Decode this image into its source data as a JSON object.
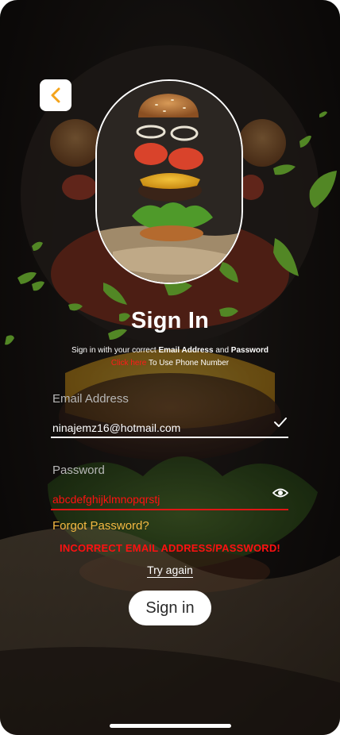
{
  "screen": {
    "title": "Sign In",
    "subtitle_part1": "Sign in with your correct ",
    "subtitle_bold1": "Email Address",
    "subtitle_and": " and ",
    "subtitle_bold2": "Password",
    "phone_link": "Click here",
    "phone_rest": " To Use Phone Number"
  },
  "form": {
    "email_label": "Email Address",
    "email_value": "ninajemz16@hotmail.com",
    "password_label": "Password",
    "password_value": "abcdefghijklmnopqrstj",
    "forgot_label": "Forgot Password?",
    "error_message": "INCORRECT EMAIL ADDRESS/PASSWORD!",
    "retry_label": "Try again",
    "submit_label": "Sign in"
  },
  "icons": {
    "back": "chevron-left-icon",
    "email_valid": "check-icon",
    "password_toggle": "eye-icon"
  },
  "colors": {
    "accent": "#f4b942",
    "error": "#ff1111",
    "link": "#ff1a1a",
    "leaf": "#7fcf3a"
  }
}
